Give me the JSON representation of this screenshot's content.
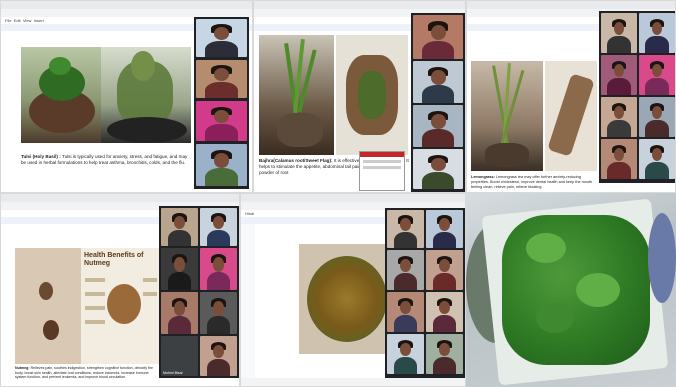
{
  "panels": {
    "top_left": {
      "menu_items": [
        "File",
        "Edit",
        "View",
        "Insert"
      ],
      "caption_title": "Tulsi (Holy Basil) :",
      "caption_body": "Tulsi is typically used for anxiety, stress, and fatigue, and may be used in herbal formulations to help treat asthma, bronchitis, colds, and the flu."
    },
    "top_middle": {
      "caption_title": "Bajhra(Calamus root/Sweet Flag):",
      "caption_body": "It is effective for digestive ailments. It helps to stimulate the appetite, abdominal tail pain and worms. The powder of root"
    },
    "top_right": {
      "caption_title": "Lemongrass:",
      "caption_body": "Lemongrass tea may offer further anxiety-reducing properties. Boost cholesterol, improve dental health and keep the mouth feeling clean, relieve pain, relieve bloating"
    },
    "bottom_left": {
      "infographic_title": "Health Benefits of Nutmeg",
      "caption_title": "Nutmeg:",
      "caption_body": "Relieves pain, soothes indigestion, strengthen cognitive function, detoxify the body, boost skin health, alleviate oral conditions, reduce insomnia, increase immune system function, and prevent leukemia, and improve blood circulation.",
      "tile_name": "Mohini Bisal"
    },
    "bottom_middle": {
      "doc_title": "Hindi"
    }
  },
  "colors": {
    "tab_bg": "#e8eaed",
    "toolbar_bg": "#f1f3f4",
    "meet_bg": "#202124",
    "link": "#1a73e8"
  },
  "icons": [
    "chrome-tab-icon",
    "docs-icon",
    "meet-grid-icon"
  ]
}
